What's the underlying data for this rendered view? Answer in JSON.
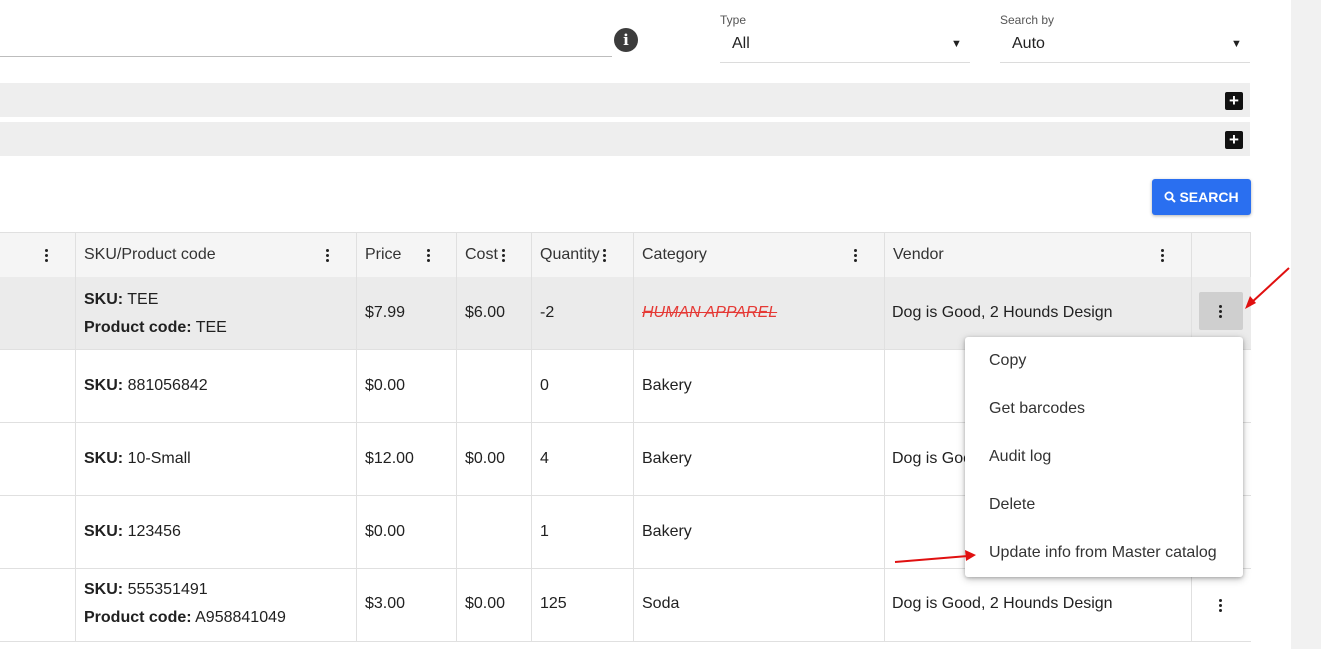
{
  "filters": {
    "type": {
      "label": "Type",
      "value": "All"
    },
    "search_by": {
      "label": "Search by",
      "value": "Auto"
    }
  },
  "search_button": {
    "label": "SEARCH"
  },
  "icons": {
    "info": "info-icon",
    "expand": "plus-icon",
    "search": "search-icon",
    "column_menu": "more-vert-icon",
    "row_menu": "more-vert-icon",
    "dropdown": "caret-down-icon"
  },
  "table": {
    "headers": [
      "SKU/Product code",
      "Price",
      "Cost",
      "Quantity",
      "Category",
      "Vendor"
    ],
    "rows": [
      {
        "sku_label": "SKU:",
        "sku": "TEE",
        "code_label": "Product code:",
        "code": "TEE",
        "price": "$7.99",
        "cost": "$6.00",
        "quantity": "-2",
        "category": "HUMAN APPAREL",
        "vendor": "Dog is Good, 2 Hounds Design"
      },
      {
        "sku_label": "SKU:",
        "sku": "881056842",
        "price": "$0.00",
        "cost": "",
        "quantity": "0",
        "category": "Bakery",
        "vendor": ""
      },
      {
        "sku_label": "SKU:",
        "sku": "10-Small",
        "price": "$12.00",
        "cost": "$0.00",
        "quantity": "4",
        "category": "Bakery",
        "vendor": "Dog is Goo"
      },
      {
        "sku_label": "SKU:",
        "sku": "123456",
        "price": "$0.00",
        "cost": "",
        "quantity": "1",
        "category": "Bakery",
        "vendor": ""
      },
      {
        "sku_label": "SKU:",
        "sku": "555351491",
        "code_label": "Product code:",
        "code": "A958841049",
        "price": "$3.00",
        "cost": "$0.00",
        "quantity": "125",
        "category": "Soda",
        "vendor": "Dog is Good, 2 Hounds Design"
      }
    ]
  },
  "row_menu": {
    "items": [
      "Copy",
      "Get barcodes",
      "Audit log",
      "Delete",
      "Update info from Master catalog"
    ]
  },
  "colors": {
    "primary": "#2a6ff0",
    "annotation_arrow": "#e01010",
    "strike_text": "#e53935",
    "highlight_row": "#ebebeb"
  }
}
